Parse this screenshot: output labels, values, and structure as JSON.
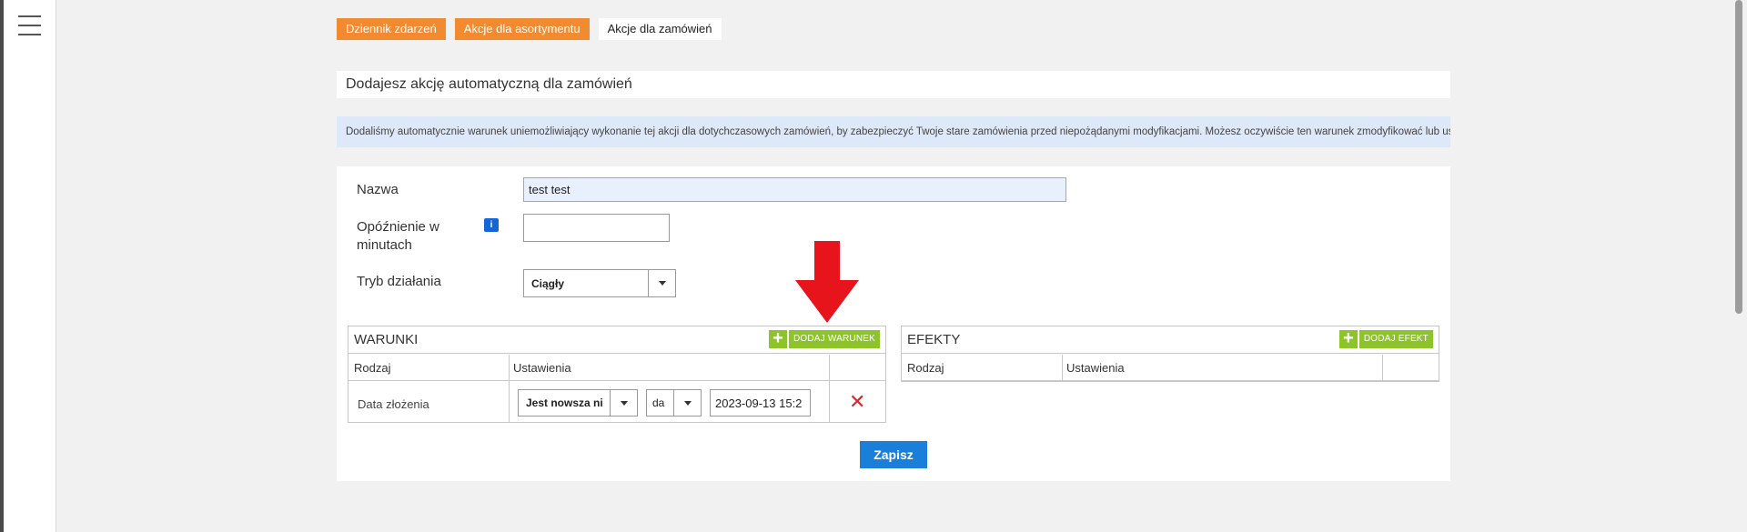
{
  "tabs": [
    {
      "label": "Dziennik zdarzeń",
      "color": "#f28a30"
    },
    {
      "label": "Akcje dla asortymentu",
      "color": "#f28a30"
    },
    {
      "label": "Akcje dla zamówień",
      "color": "#ffffff"
    }
  ],
  "header": {
    "title": "Dodajesz akcję automatyczną dla zamówień"
  },
  "info": {
    "text": "Dodaliśmy automatycznie warunek uniemożliwiający wykonanie tej akcji dla dotychczasowych zamówień, by zabezpieczyć Twoje stare zamówienia przed niepożądanymi modyfikacjami. Możesz oczywiście ten warunek zmodyfikować lub usunąć."
  },
  "form": {
    "name_label": "Nazwa",
    "name_value": "test test",
    "delay_label_1": "Opóźnienie w",
    "delay_label_2": "minutach",
    "delay_info_icon": "i",
    "delay_value": "",
    "mode_label": "Tryb działania",
    "mode_value": "Ciągły"
  },
  "conditions": {
    "title": "WARUNKI",
    "add_label": "DODAJ WARUNEK",
    "col_type": "Rodzaj",
    "col_settings": "Ustawienia",
    "rows": [
      {
        "type": "Data złożenia",
        "operator": "Jest nowsza ni",
        "unit": "da",
        "date": "2023-09-13 15:2"
      }
    ]
  },
  "effects": {
    "title": "EFEKTY",
    "add_label": "DODAJ EFEKT",
    "col_type": "Rodzaj",
    "col_settings": "Ustawienia"
  },
  "save_label": "Zapisz",
  "colors": {
    "accent_orange": "#f28a30",
    "add_green": "#8cc42a",
    "save_blue": "#1a7fd9",
    "delete_red": "#d9262b",
    "arrow_red": "#e8141c"
  }
}
